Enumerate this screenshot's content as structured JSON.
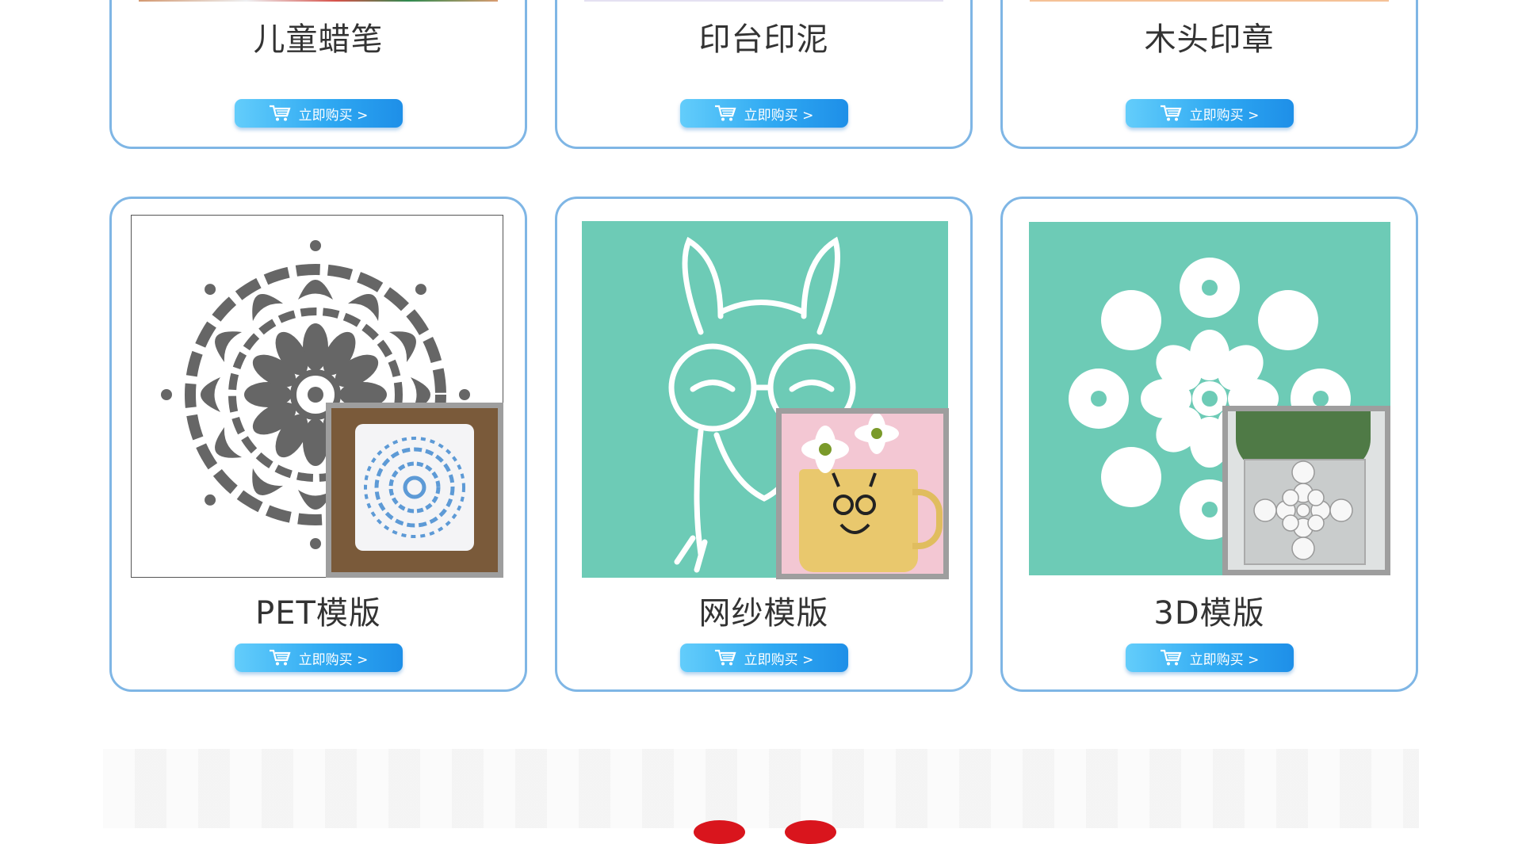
{
  "top_cards": [
    {
      "title": "儿童蜡笔",
      "button": "立即购买 >",
      "strip_color": "#e8a06d"
    },
    {
      "title": "印台印泥",
      "button": "立即购买 >",
      "strip_color": "#e4e1f2"
    },
    {
      "title": "木头印章",
      "button": "立即购买 >",
      "strip_color": "#f5c197"
    }
  ],
  "bottom_cards": [
    {
      "title": "PET模版",
      "button": "立即购买 >"
    },
    {
      "title": "网纱模版",
      "button": "立即购买 >"
    },
    {
      "title": "3D模版",
      "button": "立即购买 >"
    }
  ],
  "colors": {
    "card_border": "#7fb6e5",
    "button_blue": "#2fa9f2",
    "mint": "#6dcbb6",
    "stencil_gray": "#666666"
  },
  "icons": {
    "cart": "shopping-cart-icon"
  }
}
